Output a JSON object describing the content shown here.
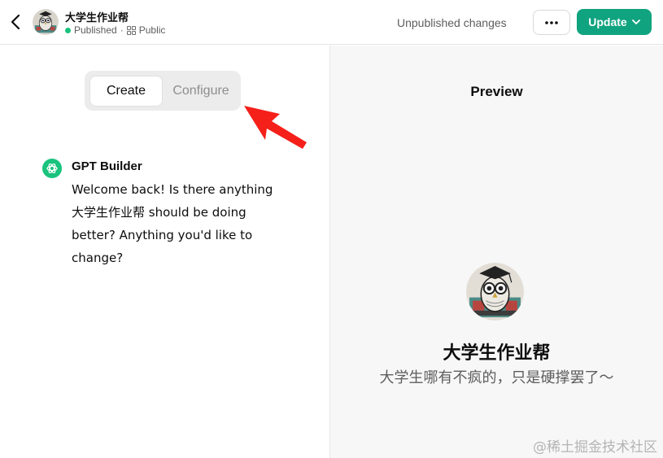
{
  "header": {
    "gpt_name": "大学生作业帮",
    "published_label": "Published",
    "separator": "·",
    "visibility_label": "Public",
    "unpublished_text": "Unpublished changes",
    "more_icon": "ellipsis-icon",
    "update_label": "Update"
  },
  "editor": {
    "tabs": [
      {
        "label": "Create",
        "active": true
      },
      {
        "label": "Configure",
        "active": false
      }
    ]
  },
  "chat": {
    "author": "GPT Builder",
    "message": "Welcome back! Is there anything 大学生作业帮 should be doing better? Anything you'd like to change?"
  },
  "preview": {
    "title": "Preview",
    "gpt_name": "大学生作业帮",
    "description": "大学生哪有不疯的，只是硬撑罢了～"
  },
  "watermark": "@稀土掘金技术社区",
  "colors": {
    "accent": "#10a37f",
    "annotation_arrow": "#f5201a",
    "published_dot": "#19c37d"
  }
}
